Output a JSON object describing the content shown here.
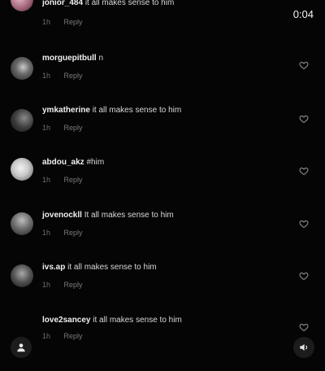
{
  "timer": "0:04",
  "reply_label": "Reply",
  "comments": [
    {
      "username": "jonior_484",
      "text": "it all makes sense to him",
      "age": "1h"
    },
    {
      "username": "morguepitbull",
      "text": "n",
      "age": "1h"
    },
    {
      "username": "ymkatherine",
      "text": "it all makes sense to him",
      "age": "1h"
    },
    {
      "username": "abdou_akz",
      "text": "#him",
      "age": "1h"
    },
    {
      "username": "jovenockll",
      "text": "It all makes sense to him",
      "age": "1h"
    },
    {
      "username": "ivs.ap",
      "text": "it all makes sense to him",
      "age": "1h"
    },
    {
      "username": "love2sancey",
      "text": "it all makes sense to him",
      "age": "1h"
    }
  ],
  "icons": {
    "heart": "heart-icon",
    "person": "person-icon",
    "volume": "volume-icon"
  }
}
